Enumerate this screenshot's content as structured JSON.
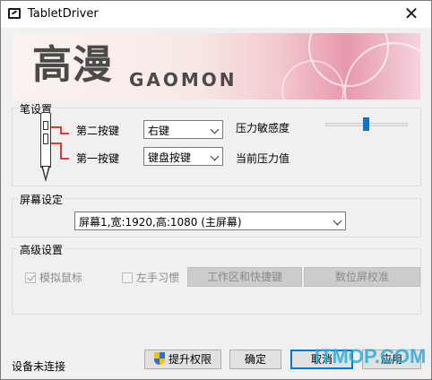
{
  "window": {
    "title": "TabletDriver",
    "close_glyph": "✕"
  },
  "banner": {
    "logo_cn": "高漫",
    "logo_en": "GAOMON"
  },
  "pen_settings": {
    "group_title": "笔设置",
    "button2_label": "第二按键",
    "button2_value": "右键",
    "button1_label": "第一按键",
    "button1_value": "键盘按键",
    "pressure_sensitivity_label": "压力敏感度",
    "pressure_sensitivity_level": 0.47,
    "current_pressure_label": "当前压力值"
  },
  "screen_settings": {
    "group_title": "屏幕设定",
    "screen_value": "屏幕1,宽:1920,高:1080 (主屏幕)"
  },
  "advanced_settings": {
    "group_title": "高级设置",
    "simulate_mouse_label": "模拟鼠标",
    "simulate_mouse_checked": true,
    "left_hand_label": "左手习惯",
    "left_hand_checked": false,
    "work_area_button": "工作区和快捷键",
    "calibrate_button": "数位屏校准"
  },
  "footer": {
    "status": "设备未连接",
    "elevate_button": "提升权限",
    "ok_button": "确定",
    "cancel_button": "取消",
    "apply_button": "应用"
  },
  "watermark": "ITMOP.COM",
  "colors": {
    "accent": "#0078d7",
    "leader_lines": "#e33333"
  }
}
